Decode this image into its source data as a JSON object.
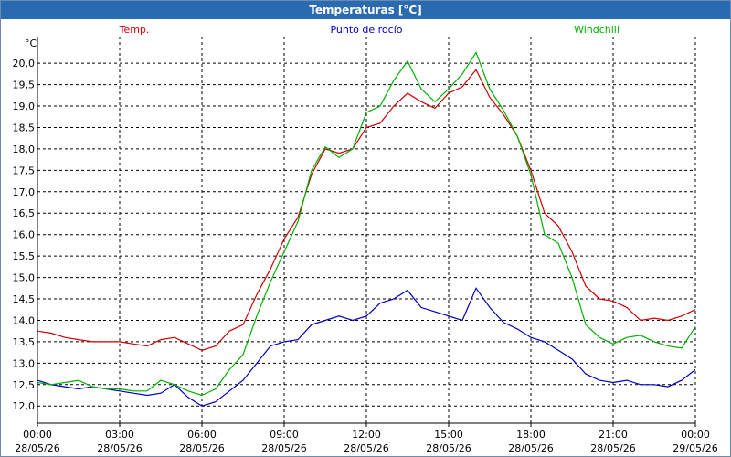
{
  "window": {
    "title": "Temperaturas [°C]"
  },
  "colors": {
    "temp": "#d00000",
    "dewpoint": "#0000c0",
    "windchill": "#00b000",
    "titlebar": "#2a6ab0"
  },
  "chart_data": {
    "type": "line",
    "title": "Temperaturas [°C]",
    "ylabel": "°C",
    "ylim": [
      11.6,
      20.6
    ],
    "xlim": [
      "2026-05-28T00:00",
      "2026-05-29T00:00"
    ],
    "grid": true,
    "legend_position": "top",
    "yticks": [
      "20,0",
      "19,5",
      "19,0",
      "18,5",
      "18,0",
      "17,5",
      "17,0",
      "16,5",
      "16,0",
      "15,5",
      "15,0",
      "14,5",
      "14,0",
      "13,5",
      "13,0",
      "12,5",
      "12,0"
    ],
    "xticks": [
      {
        "time": "00:00",
        "date": "28/05/26"
      },
      {
        "time": "03:00",
        "date": "28/05/26"
      },
      {
        "time": "06:00",
        "date": "28/05/26"
      },
      {
        "time": "09:00",
        "date": "28/05/26"
      },
      {
        "time": "12:00",
        "date": "28/05/26"
      },
      {
        "time": "15:00",
        "date": "28/05/26"
      },
      {
        "time": "18:00",
        "date": "28/05/26"
      },
      {
        "time": "21:00",
        "date": "28/05/26"
      },
      {
        "time": "00:00",
        "date": "29/05/26"
      }
    ],
    "x": [
      "00:00",
      "00:30",
      "01:00",
      "01:30",
      "02:00",
      "02:30",
      "03:00",
      "03:30",
      "04:00",
      "04:30",
      "05:00",
      "05:30",
      "06:00",
      "06:30",
      "07:00",
      "07:30",
      "08:00",
      "08:30",
      "09:00",
      "09:30",
      "10:00",
      "10:30",
      "11:00",
      "11:30",
      "12:00",
      "12:30",
      "13:00",
      "13:30",
      "14:00",
      "14:30",
      "15:00",
      "15:30",
      "16:00",
      "16:30",
      "17:00",
      "17:30",
      "18:00",
      "18:30",
      "19:00",
      "19:30",
      "20:00",
      "20:30",
      "21:00",
      "21:30",
      "22:00",
      "22:30",
      "23:00",
      "23:30",
      "24:00"
    ],
    "series": [
      {
        "name": "Temp.",
        "values": [
          13.75,
          13.7,
          13.6,
          13.55,
          13.5,
          13.5,
          13.5,
          13.45,
          13.4,
          13.55,
          13.6,
          13.45,
          13.3,
          13.4,
          13.75,
          13.9,
          14.6,
          15.2,
          15.9,
          16.4,
          17.4,
          18.0,
          17.9,
          18.0,
          18.5,
          18.6,
          19.0,
          19.3,
          19.1,
          18.95,
          19.3,
          19.45,
          19.85,
          19.2,
          18.8,
          18.3,
          17.5,
          16.5,
          16.2,
          15.6,
          14.8,
          14.5,
          14.45,
          14.3,
          14.0,
          14.05,
          14.0,
          14.1,
          14.25
        ]
      },
      {
        "name": "Punto de rocío",
        "values": [
          12.6,
          12.5,
          12.45,
          12.4,
          12.45,
          12.4,
          12.35,
          12.3,
          12.25,
          12.3,
          12.5,
          12.2,
          12.0,
          12.1,
          12.35,
          12.6,
          13.0,
          13.4,
          13.5,
          13.55,
          13.9,
          14.0,
          14.1,
          14.0,
          14.1,
          14.4,
          14.5,
          14.7,
          14.3,
          14.2,
          14.1,
          14.0,
          14.75,
          14.3,
          13.95,
          13.8,
          13.6,
          13.5,
          13.3,
          13.1,
          12.75,
          12.6,
          12.55,
          12.6,
          12.5,
          12.5,
          12.45,
          12.6,
          12.85
        ]
      },
      {
        "name": "Windchill",
        "values": [
          12.55,
          12.5,
          12.55,
          12.6,
          12.45,
          12.4,
          12.4,
          12.35,
          12.35,
          12.6,
          12.5,
          12.35,
          12.25,
          12.4,
          12.85,
          13.2,
          14.1,
          14.9,
          15.6,
          16.3,
          17.5,
          18.05,
          17.8,
          18.0,
          18.85,
          19.0,
          19.6,
          20.05,
          19.4,
          19.1,
          19.4,
          19.75,
          20.25,
          19.4,
          18.9,
          18.3,
          17.4,
          16.0,
          15.8,
          15.0,
          13.9,
          13.6,
          13.45,
          13.6,
          13.65,
          13.5,
          13.4,
          13.35,
          13.85
        ]
      }
    ]
  }
}
